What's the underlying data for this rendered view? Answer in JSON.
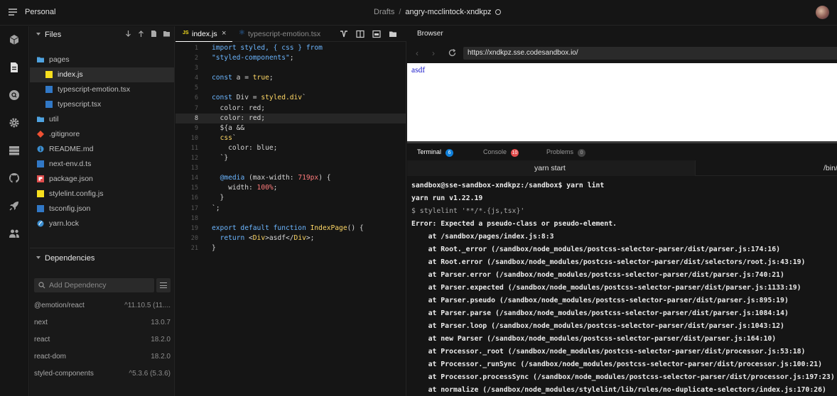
{
  "topbar": {
    "workspace": "Personal",
    "breadcrumb_folder": "Drafts",
    "breadcrumb_separator": "/",
    "sandbox_name": "angry-mcclintock-xndkpz"
  },
  "sidebar": {
    "files_title": "Files",
    "tree": [
      {
        "label": "pages",
        "icon": "folder-open-icon"
      },
      {
        "label": "index.js",
        "icon": "js-file-icon"
      },
      {
        "label": "typescript-emotion.tsx",
        "icon": "ts-file-icon"
      },
      {
        "label": "typescript.tsx",
        "icon": "ts-file-icon"
      },
      {
        "label": "util",
        "icon": "folder-icon"
      },
      {
        "label": ".gitignore",
        "icon": "git-icon"
      },
      {
        "label": "README.md",
        "icon": "info-icon"
      },
      {
        "label": "next-env.d.ts",
        "icon": "ts-file-icon"
      },
      {
        "label": "package.json",
        "icon": "npm-icon"
      },
      {
        "label": "stylelint.config.js",
        "icon": "js-file-icon"
      },
      {
        "label": "tsconfig.json",
        "icon": "ts-file-icon"
      },
      {
        "label": "yarn.lock",
        "icon": "yarn-icon"
      }
    ],
    "dependencies_title": "Dependencies",
    "dependency_search_placeholder": "Add Dependency",
    "dependencies": [
      {
        "name": "@emotion/react",
        "version": "^11.10.5 (11...."
      },
      {
        "name": "next",
        "version": "13.0.7"
      },
      {
        "name": "react",
        "version": "18.2.0"
      },
      {
        "name": "react-dom",
        "version": "18.2.0"
      },
      {
        "name": "styled-components",
        "version": "^5.3.6 (5.3.6)"
      }
    ]
  },
  "editor": {
    "tabs": [
      {
        "icon": "JS",
        "label": "index.js",
        "close": "×"
      },
      {
        "icon": "⚛",
        "label": "typescript-emotion.tsx"
      }
    ],
    "line_numbers": [
      "1",
      "2",
      "3",
      "4",
      "5",
      "6",
      "7",
      "8",
      "9",
      "10",
      "11",
      "12",
      "13",
      "14",
      "15",
      "16",
      "17",
      "18",
      "19",
      "20",
      "21"
    ]
  },
  "browser": {
    "title": "Browser",
    "back": "‹",
    "forward": "›",
    "url": "https://xndkpz.sse.codesandbox.io/",
    "page_text": "asdf"
  },
  "panel": {
    "tabs": [
      {
        "label": "Terminal",
        "count": "6"
      },
      {
        "label": "Console",
        "count": "10"
      },
      {
        "label": "Problems",
        "count": "0"
      }
    ],
    "subtabs": [
      "yarn start",
      "/bin/"
    ],
    "terminal_lines": [
      "sandbox@sse-sandbox-xndkpz:/sandbox$ yarn lint",
      "yarn run v1.22.19",
      "$ stylelint '**/*.{js,tsx}'",
      "Error: Expected a pseudo-class or pseudo-element.",
      "    at /sandbox/pages/index.js:8:3",
      "    at Root._error (/sandbox/node_modules/postcss-selector-parser/dist/parser.js:174:16)",
      "    at Root.error (/sandbox/node_modules/postcss-selector-parser/dist/selectors/root.js:43:19)",
      "    at Parser.error (/sandbox/node_modules/postcss-selector-parser/dist/parser.js:740:21)",
      "    at Parser.expected (/sandbox/node_modules/postcss-selector-parser/dist/parser.js:1133:19)",
      "    at Parser.pseudo (/sandbox/node_modules/postcss-selector-parser/dist/parser.js:895:19)",
      "    at Parser.parse (/sandbox/node_modules/postcss-selector-parser/dist/parser.js:1084:14)",
      "    at Parser.loop (/sandbox/node_modules/postcss-selector-parser/dist/parser.js:1043:12)",
      "    at new Parser (/sandbox/node_modules/postcss-selector-parser/dist/parser.js:164:10)",
      "    at Processor._root (/sandbox/node_modules/postcss-selector-parser/dist/processor.js:53:18)",
      "    at Processor._runSync (/sandbox/node_modules/postcss-selector-parser/dist/processor.js:100:21)",
      "    at Processor.processSync (/sandbox/node_modules/postcss-selector-parser/dist/processor.js:197:23)",
      "    at normalize (/sandbox/node_modules/stylelint/lib/rules/no-duplicate-selectors/index.js:170:26)"
    ]
  },
  "code_lines": [
    [
      [
        "import styled, { css } from",
        "kw"
      ]
    ],
    [
      [
        "\"styled-components\"",
        "str"
      ],
      [
        ";",
        ""
      ]
    ],
    [],
    [
      [
        "const ",
        "kw"
      ],
      [
        "a = ",
        ""
      ],
      [
        "true",
        "bool"
      ],
      [
        ";",
        ""
      ]
    ],
    [],
    [
      [
        "const ",
        "kw"
      ],
      [
        "Div = ",
        ""
      ],
      [
        "styled.div",
        "fn"
      ],
      [
        "`",
        ""
      ]
    ],
    [
      [
        "  color: red;",
        ""
      ]
    ],
    [
      [
        "  color: red;",
        ""
      ]
    ],
    [
      [
        "  ${a &&",
        ""
      ]
    ],
    [
      [
        "  ",
        ""
      ],
      [
        "css",
        "fn"
      ],
      [
        "`",
        ""
      ]
    ],
    [
      [
        "    color: blue;",
        ""
      ]
    ],
    [
      [
        "  `}",
        ""
      ]
    ],
    [],
    [
      [
        "  ",
        ""
      ],
      [
        "@media",
        "at"
      ],
      [
        " (max-width: ",
        ""
      ],
      [
        "719px",
        "num"
      ],
      [
        ") {",
        ""
      ]
    ],
    [
      [
        "    width: ",
        ""
      ],
      [
        "100%",
        "num"
      ],
      [
        ";",
        ""
      ]
    ],
    [
      [
        "  }",
        ""
      ]
    ],
    [
      [
        "`;",
        ""
      ]
    ],
    [],
    [
      [
        "export default function ",
        "kw"
      ],
      [
        "IndexPage",
        "fn"
      ],
      [
        "() {",
        ""
      ]
    ],
    [
      [
        "  ",
        ""
      ],
      [
        "return ",
        "kw"
      ],
      [
        "<",
        ""
      ],
      [
        "Div",
        "tag"
      ],
      [
        ">asdf</",
        ""
      ],
      [
        "Div",
        "tag"
      ],
      [
        ">;",
        ""
      ]
    ],
    [
      [
        "}",
        ""
      ]
    ]
  ],
  "colors": {
    "js_icon": "#f7df1e",
    "ts_icon": "#3178c6",
    "folder": "#4fa3e0",
    "git": "#f05133",
    "npm": "#e04d4d",
    "yarn": "#3c8fd1",
    "terminal_badge": "#0f7fd9",
    "console_badge": "#e24b4b"
  }
}
